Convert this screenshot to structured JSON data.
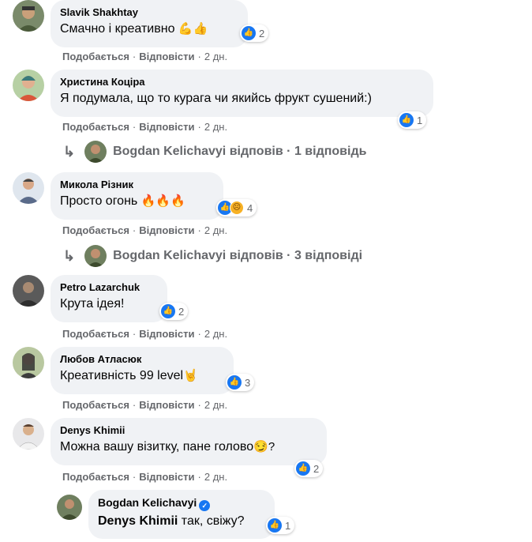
{
  "actions": {
    "like": "Подобається",
    "reply": "Відповісти",
    "sep": "·"
  },
  "comments": [
    {
      "author": "Slavik Shakhtay",
      "text": "Смачно і креативно",
      "emoji": "💪👍",
      "reactions": "2",
      "time": "2 дн."
    },
    {
      "author": "Христина Коціра",
      "text": "Я подумала, що то курага чи якийсь фрукт сушений:)",
      "emoji": "",
      "reactions": "1",
      "time": "2 дн.",
      "replies": {
        "author": "Bogdan Kelichavyi",
        "verb": "відповів",
        "sep": "·",
        "count": "1 відповідь"
      }
    },
    {
      "author": "Микола Різник",
      "text": "Просто огонь",
      "emoji": "🔥🔥🔥",
      "reactions": "4",
      "time": "2 дн.",
      "replies": {
        "author": "Bogdan Kelichavyi",
        "verb": "відповів",
        "sep": "·",
        "count": "3 відповіді"
      }
    },
    {
      "author": "Petro Lazarchuk",
      "text": "Крута ідея!",
      "emoji": "",
      "reactions": "2",
      "time": "2 дн."
    },
    {
      "author": "Любов Атласюк",
      "text": "Креативність 99 level",
      "emoji": "🤘",
      "reactions": "3",
      "time": "2 дн."
    },
    {
      "author": "Denys Khimii",
      "text": "Можна вашу візитку, пане голово",
      "emoji": "😏?",
      "reactions": "2",
      "time": "2 дн."
    }
  ],
  "reply": {
    "author": "Bogdan Kelichavyi",
    "mention": "Denys Khimii",
    "text": " так, свіжу?",
    "reactions": "1"
  },
  "icons": {
    "like": "thumbs-up-icon",
    "sad": "sad-face-icon",
    "verified": "verified-badge-icon",
    "reply_arrow": "reply-arrow-icon"
  },
  "colors": {
    "bubble": "#f0f2f5",
    "meta": "#65676b",
    "like": "#1877f2"
  }
}
